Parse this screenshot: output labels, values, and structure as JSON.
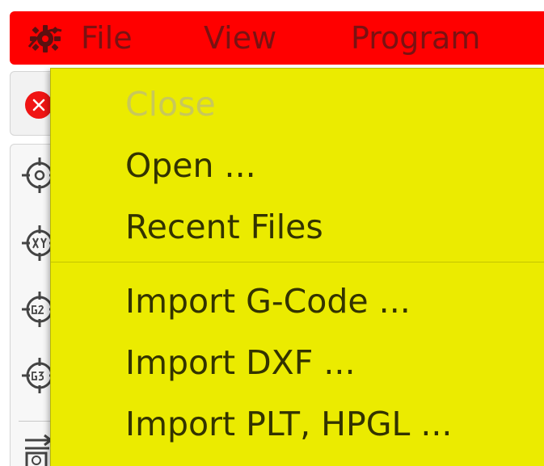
{
  "menubar": {
    "app_icon": "gear-icon",
    "items": [
      {
        "label": "File"
      },
      {
        "label": "View"
      },
      {
        "label": "Program"
      }
    ]
  },
  "side": {
    "close_icon": "close-icon",
    "tool_icons": [
      "target-origin-icon",
      "target-xy-icon",
      "target-g28-icon",
      "target-g30-icon",
      "settings-list-icon"
    ]
  },
  "dropdown": {
    "items": [
      {
        "label": "Close",
        "enabled": false
      },
      {
        "label": "Open ...",
        "enabled": true
      },
      {
        "label": "Recent Files",
        "enabled": true
      },
      {
        "label": "Import G-Code ...",
        "enabled": true
      },
      {
        "label": "Import DXF ...",
        "enabled": true
      },
      {
        "label": "Import PLT, HPGL ...",
        "enabled": true
      }
    ]
  },
  "colors": {
    "menubar_bg": "#ff0000",
    "menubar_text": "#7a1212",
    "dropdown_bg": "#ebeb00",
    "dropdown_text": "#333300",
    "disabled_text": "#c8c85a"
  }
}
